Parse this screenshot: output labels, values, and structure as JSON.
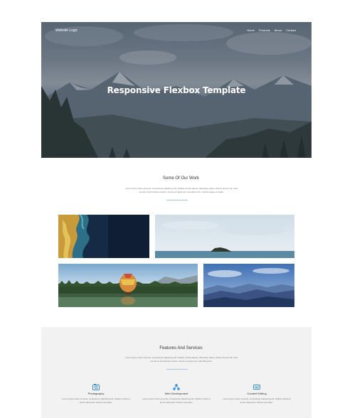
{
  "hero": {
    "logo": "Website Logo",
    "nav": [
      "Home",
      "Products",
      "About",
      "Contact"
    ],
    "title": "Responsive Flexbox Template"
  },
  "work": {
    "title": "Some Of Our Work",
    "description": "Lorem ipsum dolor sit amet, consectetur adipiscing elit. Nullam id felis aliquet, bibendum tellus, ultrices laoreet dui. Sed vel dui ut nisl ultricies pretium. Donec at ligula vel, imperdiet justo. Cras at augue at ligula."
  },
  "features": {
    "title": "Features And Services",
    "description": "Lorem ipsum dolor sit amet, consectetur adipiscing elit. Nullam id felis aliquet, bibendum tellus, ultrices laoreet dui. Sed vel dui ut nisl ultricies pretium. Donec at ligula vel, imperdiet justo.",
    "items": [
      {
        "icon": "camera-icon",
        "title": "Photography",
        "description": "Lorem ipsum dolor sit amet, consectetur adipiscing elit. Nullam id felis et ipsum bibendum ultrices sed diam."
      },
      {
        "icon": "share-nodes-icon",
        "title": "Web Development",
        "description": "Lorem ipsum dolor sit amet, consectetur adipiscing elit. Nullam id felis et ipsum bibendum ultrices sed diam."
      },
      {
        "icon": "keyboard-icon",
        "title": "Content Editing",
        "description": "Lorem ipsum dolor sit amet, consectetur adipiscing elit. Nullam id felis et ipsum bibendum ultrices sed diam."
      }
    ]
  },
  "colors": {
    "accent": "#3a8fd0",
    "divider": "#aac7de",
    "features_bg": "#f2f2f2"
  }
}
